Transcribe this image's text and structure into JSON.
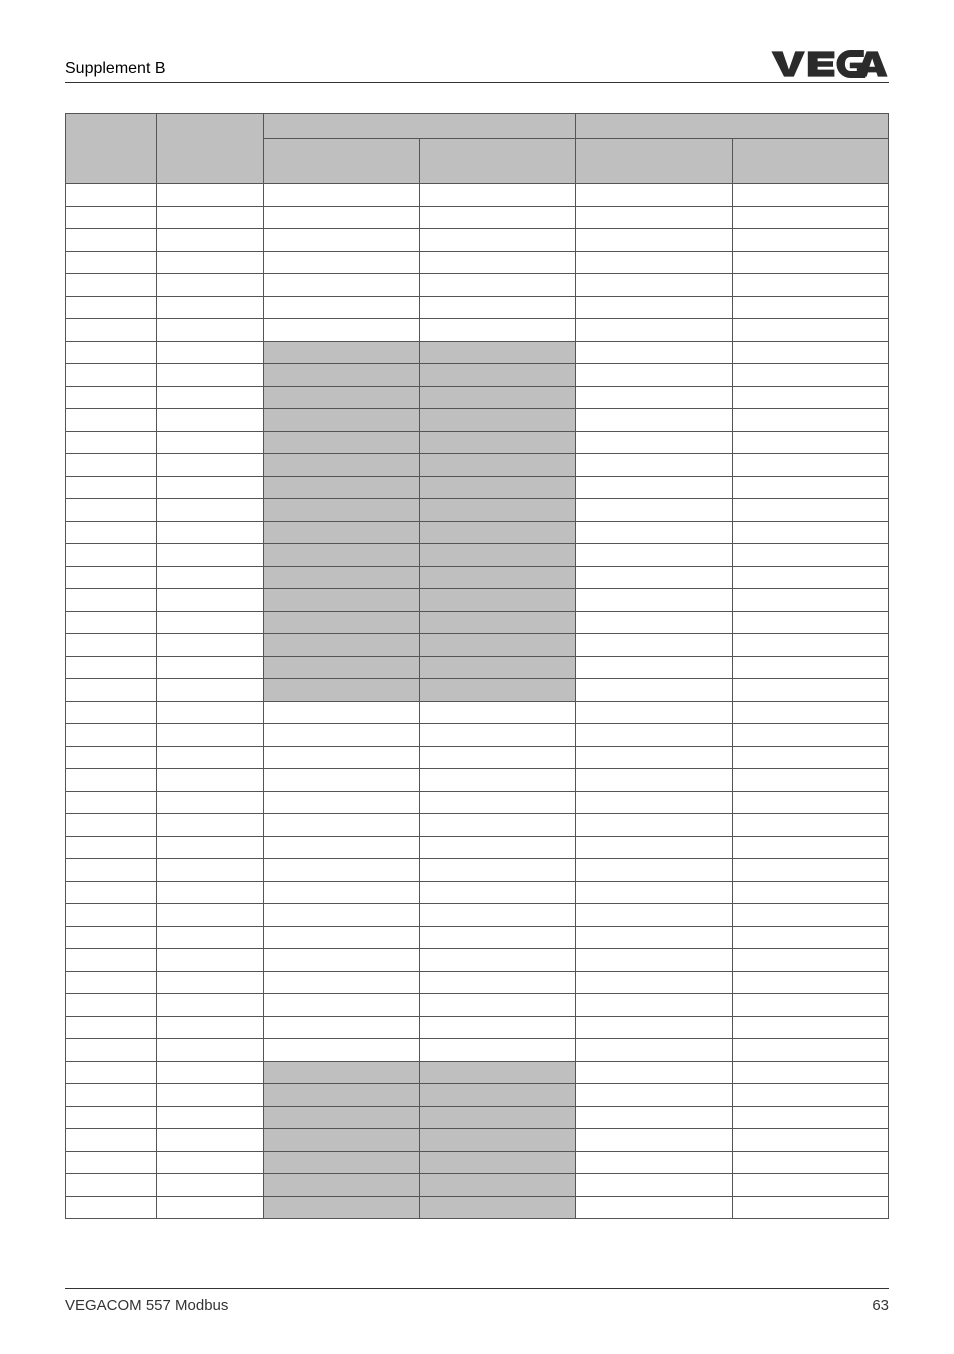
{
  "header": {
    "title": "Supplement B"
  },
  "footer": {
    "left": "VEGACOM 557 Modbus",
    "page": "63"
  },
  "table": {
    "rows": [
      {
        "shaded_cols": []
      },
      {
        "shaded_cols": []
      },
      {
        "shaded_cols": []
      },
      {
        "shaded_cols": []
      },
      {
        "shaded_cols": []
      },
      {
        "shaded_cols": []
      },
      {
        "shaded_cols": []
      },
      {
        "shaded_cols": [
          2,
          3
        ]
      },
      {
        "shaded_cols": [
          2,
          3
        ]
      },
      {
        "shaded_cols": [
          2,
          3
        ]
      },
      {
        "shaded_cols": [
          2,
          3
        ]
      },
      {
        "shaded_cols": [
          2,
          3
        ]
      },
      {
        "shaded_cols": [
          2,
          3
        ]
      },
      {
        "shaded_cols": [
          2,
          3
        ]
      },
      {
        "shaded_cols": [
          2,
          3
        ]
      },
      {
        "shaded_cols": [
          2,
          3
        ]
      },
      {
        "shaded_cols": [
          2,
          3
        ]
      },
      {
        "shaded_cols": [
          2,
          3
        ]
      },
      {
        "shaded_cols": [
          2,
          3
        ]
      },
      {
        "shaded_cols": [
          2,
          3
        ]
      },
      {
        "shaded_cols": [
          2,
          3
        ]
      },
      {
        "shaded_cols": [
          2,
          3
        ]
      },
      {
        "shaded_cols": [
          2,
          3
        ]
      },
      {
        "shaded_cols": []
      },
      {
        "shaded_cols": []
      },
      {
        "shaded_cols": []
      },
      {
        "shaded_cols": []
      },
      {
        "shaded_cols": []
      },
      {
        "shaded_cols": []
      },
      {
        "shaded_cols": []
      },
      {
        "shaded_cols": []
      },
      {
        "shaded_cols": []
      },
      {
        "shaded_cols": []
      },
      {
        "shaded_cols": []
      },
      {
        "shaded_cols": []
      },
      {
        "shaded_cols": []
      },
      {
        "shaded_cols": []
      },
      {
        "shaded_cols": []
      },
      {
        "shaded_cols": []
      },
      {
        "shaded_cols": [
          2,
          3
        ]
      },
      {
        "shaded_cols": [
          2,
          3
        ]
      },
      {
        "shaded_cols": [
          2,
          3
        ]
      },
      {
        "shaded_cols": [
          2,
          3
        ]
      },
      {
        "shaded_cols": [
          2,
          3
        ]
      },
      {
        "shaded_cols": [
          2,
          3
        ]
      },
      {
        "shaded_cols": [
          2,
          3
        ]
      }
    ]
  }
}
